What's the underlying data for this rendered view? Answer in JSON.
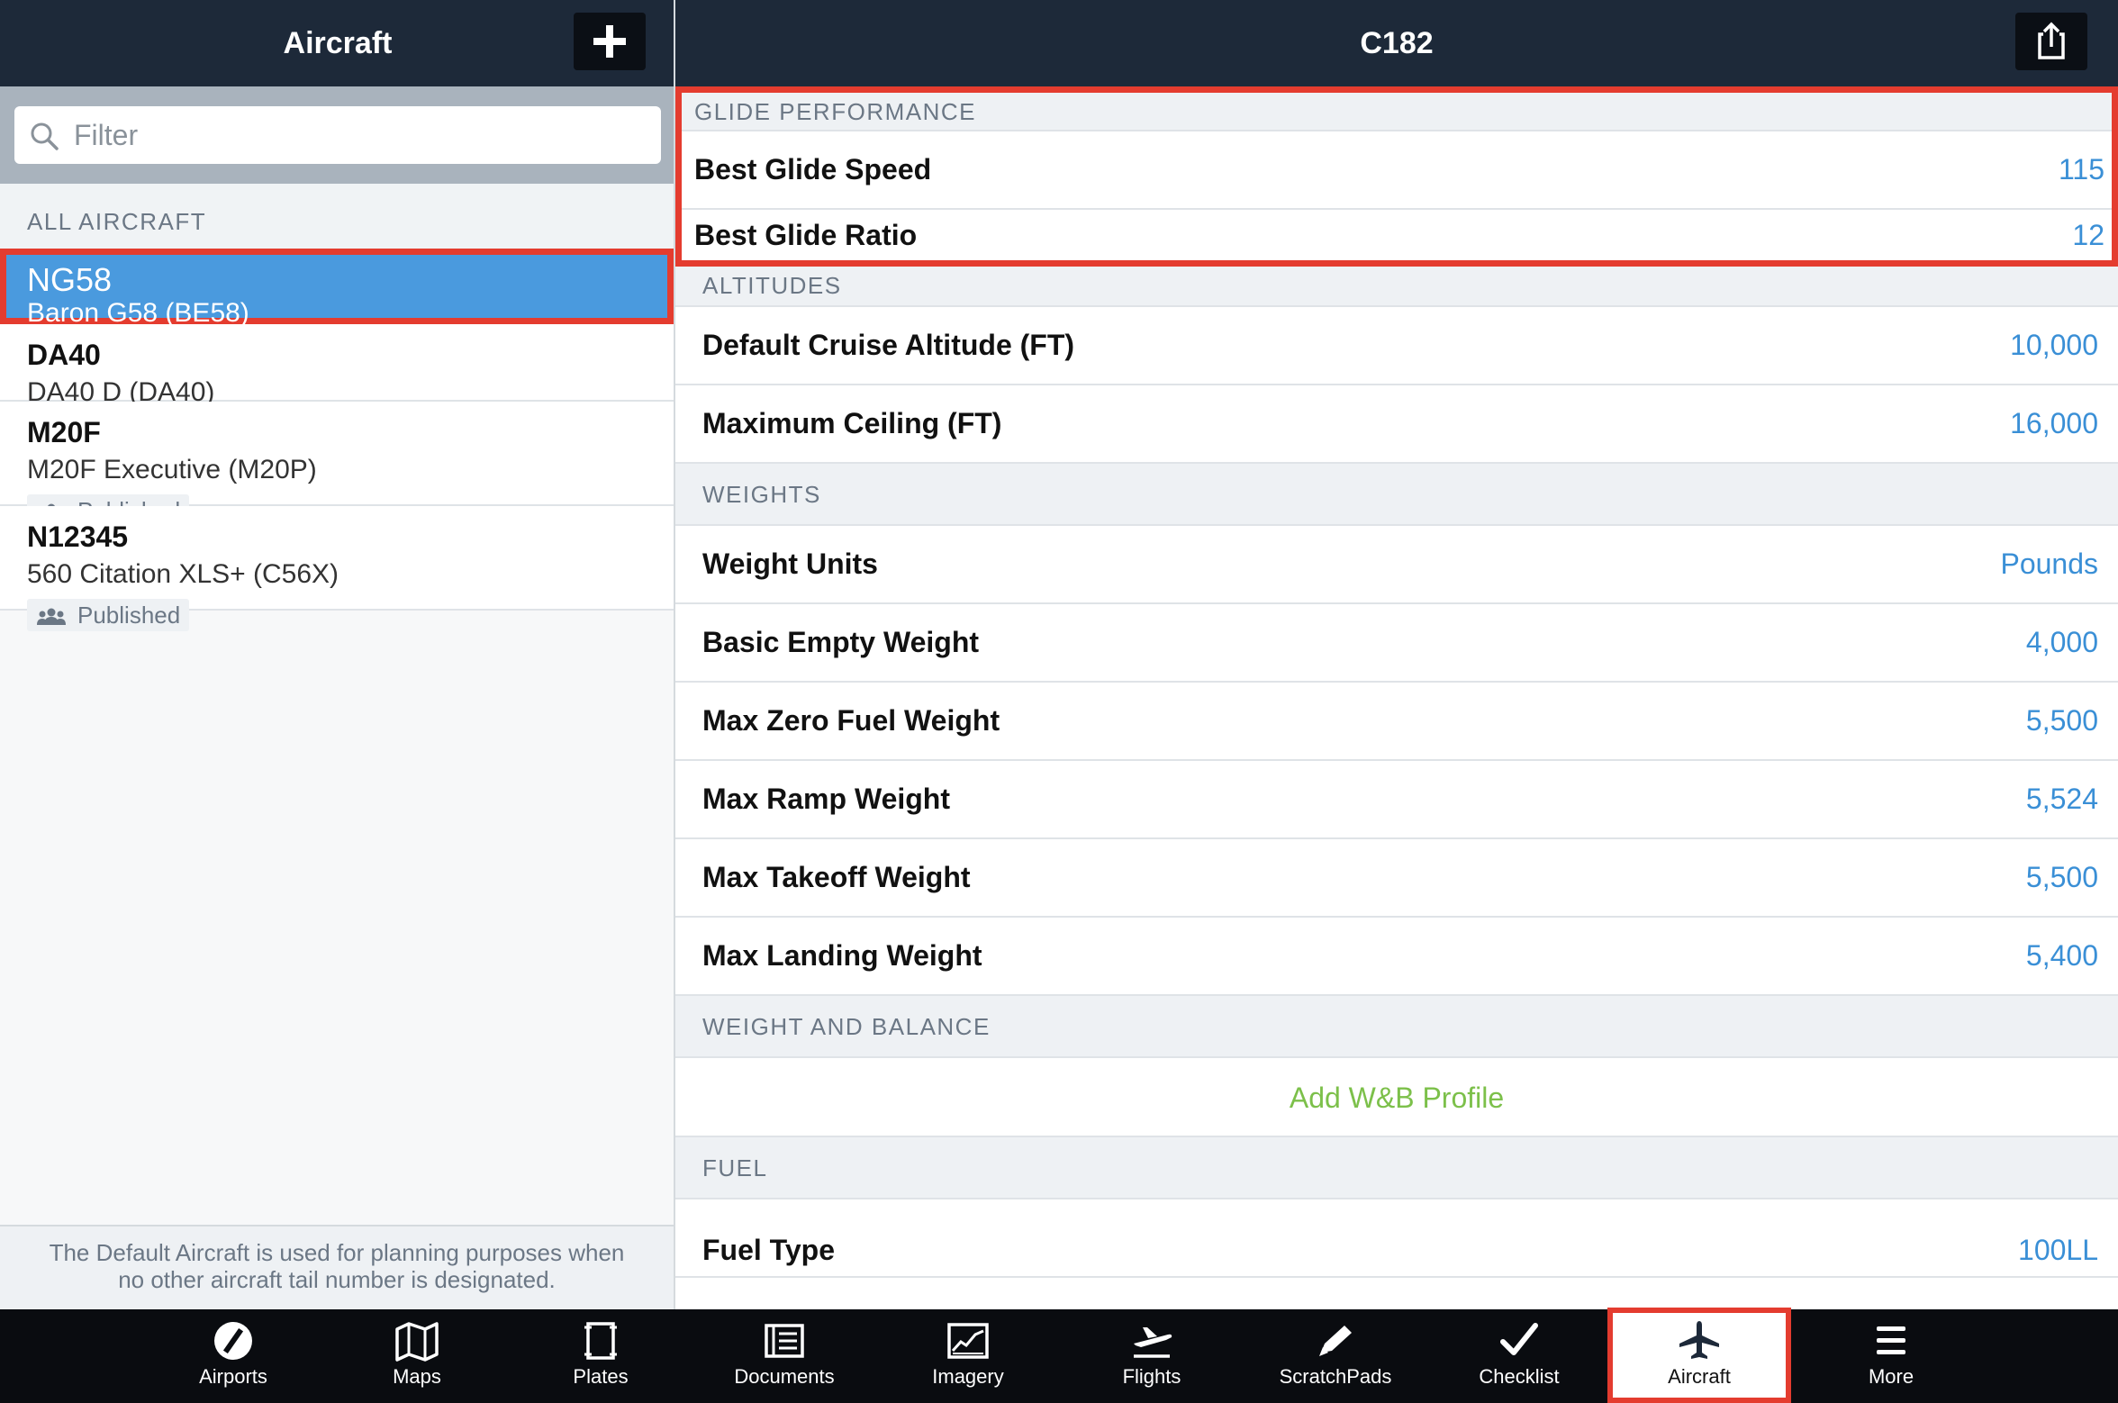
{
  "left_pane": {
    "title": "Aircraft",
    "filter_placeholder": "Filter",
    "section_label": "ALL AIRCRAFT",
    "aircraft": [
      {
        "tail": "NG58",
        "model": "Baron G58 (BE58)",
        "published": false,
        "selected": true
      },
      {
        "tail": "DA40",
        "model": "DA40 D (DA40)",
        "published": false
      },
      {
        "tail": "M20F",
        "model": "M20F Executive (M20P)",
        "published": true,
        "published_label": "Published"
      },
      {
        "tail": "N12345",
        "model": "560 Citation XLS+ (C56X)",
        "published": true,
        "published_label": "Published"
      }
    ],
    "footer_line1": "The Default Aircraft is used for planning purposes when",
    "footer_line2": "no other aircraft tail number is designated."
  },
  "right_pane": {
    "title": "C182",
    "glide": {
      "header": "GLIDE PERFORMANCE",
      "best_glide_speed_label": "Best Glide Speed",
      "best_glide_speed_value": "115",
      "best_glide_ratio_label": "Best Glide Ratio",
      "best_glide_ratio_value": "12"
    },
    "altitudes": {
      "header": "ALTITUDES",
      "cruise_label": "Default Cruise Altitude (FT)",
      "cruise_value": "10,000",
      "ceiling_label": "Maximum Ceiling (FT)",
      "ceiling_value": "16,000"
    },
    "weights": {
      "header": "WEIGHTS",
      "units_label": "Weight Units",
      "units_value": "Pounds",
      "bew_label": "Basic Empty Weight",
      "bew_value": "4,000",
      "mzfw_label": "Max Zero Fuel Weight",
      "mzfw_value": "5,500",
      "mrw_label": "Max Ramp Weight",
      "mrw_value": "5,524",
      "mtow_label": "Max Takeoff Weight",
      "mtow_value": "5,500",
      "mlw_label": "Max Landing Weight",
      "mlw_value": "5,400"
    },
    "wb": {
      "header": "WEIGHT AND BALANCE",
      "add_label": "Add W&B Profile"
    },
    "fuel": {
      "header": "FUEL",
      "type_label": "Fuel Type",
      "type_value": "100LL"
    }
  },
  "tabbar": {
    "tabs": [
      {
        "label": "Airports",
        "icon": "airports-icon"
      },
      {
        "label": "Maps",
        "icon": "maps-icon"
      },
      {
        "label": "Plates",
        "icon": "plates-icon"
      },
      {
        "label": "Documents",
        "icon": "documents-icon"
      },
      {
        "label": "Imagery",
        "icon": "imagery-icon"
      },
      {
        "label": "Flights",
        "icon": "flights-icon"
      },
      {
        "label": "ScratchPads",
        "icon": "scratchpads-icon"
      },
      {
        "label": "Checklist",
        "icon": "checklist-icon"
      },
      {
        "label": "Aircraft",
        "icon": "aircraft-icon",
        "active": true
      },
      {
        "label": "More",
        "icon": "more-icon"
      }
    ]
  },
  "colors": {
    "header_bg": "#1d2939",
    "accent_blue": "#3a8fd6",
    "selected_row": "#4a9ade",
    "highlight_red": "#e43c2f",
    "add_green": "#7cc04a"
  }
}
